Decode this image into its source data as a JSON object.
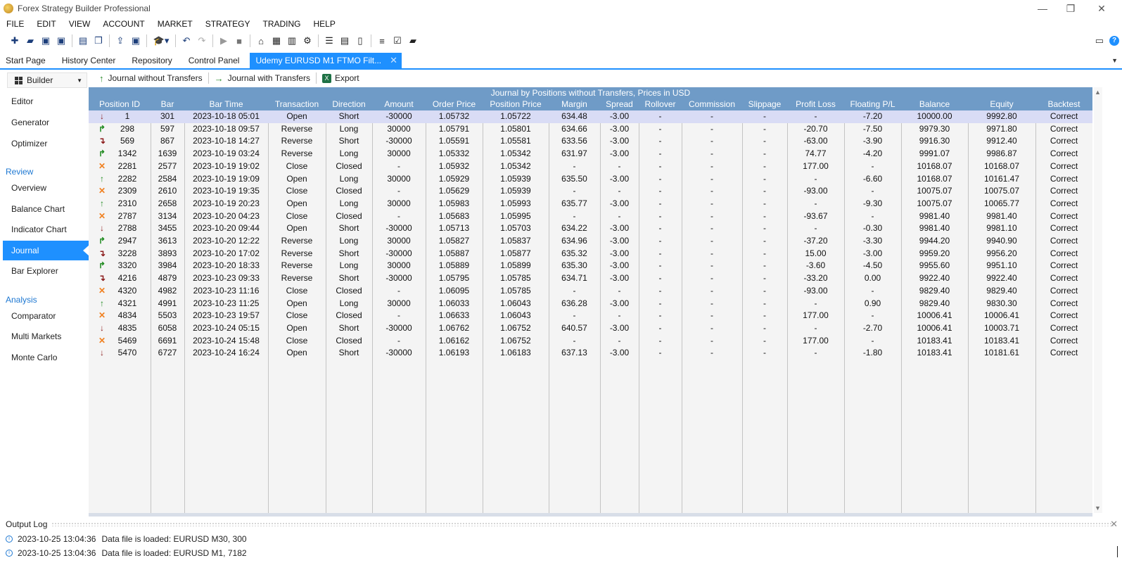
{
  "window": {
    "title": "Forex Strategy Builder Professional",
    "minimize": "—",
    "maximize": "❐",
    "close": "✕"
  },
  "menu": [
    "FILE",
    "EDIT",
    "VIEW",
    "ACCOUNT",
    "MARKET",
    "STRATEGY",
    "TRADING",
    "HELP"
  ],
  "tabs": {
    "items": [
      "Start Page",
      "History Center",
      "Repository",
      "Control Panel"
    ],
    "active": "Udemy  EURUSD  M1  FTMO  Filt...",
    "active_close": "✕"
  },
  "sidebar": {
    "builder_label": "Builder",
    "top_items": [
      "Editor",
      "Generator",
      "Optimizer"
    ],
    "review_header": "Review",
    "review_items": [
      "Overview",
      "Balance Chart",
      "Indicator Chart",
      "Journal",
      "Bar Explorer"
    ],
    "analysis_header": "Analysis",
    "analysis_items": [
      "Comparator",
      "Multi Markets",
      "Monte Carlo"
    ],
    "active_item": "Journal"
  },
  "journal_toolbar": {
    "without_transfers": "Journal without Transfers",
    "with_transfers": "Journal with Transfers",
    "export": "Export"
  },
  "grid": {
    "title": "Journal by Positions without Transfers, Prices in USD",
    "columns": [
      "Position ID",
      "Bar",
      "Bar Time",
      "Transaction",
      "Direction",
      "Amount",
      "Order Price",
      "Position Price",
      "Margin",
      "Spread",
      "Rollover",
      "Commission",
      "Slippage",
      "Profit Loss",
      "Floating P/L",
      "Balance",
      "Equity",
      "Backtest"
    ],
    "rows": [
      {
        "icon": "down",
        "c": [
          "1",
          "301",
          "2023-10-18 05:01",
          "Open",
          "Short",
          "-30000",
          "1.05732",
          "1.05722",
          "634.48",
          "-3.00",
          "-",
          "-",
          "-",
          "-",
          "-7.20",
          "10000.00",
          "9992.80",
          "Correct"
        ]
      },
      {
        "icon": "reverse-up",
        "c": [
          "298",
          "597",
          "2023-10-18 09:57",
          "Reverse",
          "Long",
          "30000",
          "1.05791",
          "1.05801",
          "634.66",
          "-3.00",
          "-",
          "-",
          "-",
          "-20.70",
          "-7.50",
          "9979.30",
          "9971.80",
          "Correct"
        ]
      },
      {
        "icon": "reverse-down",
        "c": [
          "569",
          "867",
          "2023-10-18 14:27",
          "Reverse",
          "Short",
          "-30000",
          "1.05591",
          "1.05581",
          "633.56",
          "-3.00",
          "-",
          "-",
          "-",
          "-63.00",
          "-3.90",
          "9916.30",
          "9912.40",
          "Correct"
        ]
      },
      {
        "icon": "reverse-up",
        "c": [
          "1342",
          "1639",
          "2023-10-19 03:24",
          "Reverse",
          "Long",
          "30000",
          "1.05332",
          "1.05342",
          "631.97",
          "-3.00",
          "-",
          "-",
          "-",
          "74.77",
          "-4.20",
          "9991.07",
          "9986.87",
          "Correct"
        ]
      },
      {
        "icon": "close",
        "c": [
          "2281",
          "2577",
          "2023-10-19 19:02",
          "Close",
          "Closed",
          "-",
          "1.05932",
          "1.05342",
          "-",
          "-",
          "-",
          "-",
          "-",
          "177.00",
          "-",
          "10168.07",
          "10168.07",
          "Correct"
        ]
      },
      {
        "icon": "up",
        "c": [
          "2282",
          "2584",
          "2023-10-19 19:09",
          "Open",
          "Long",
          "30000",
          "1.05929",
          "1.05939",
          "635.50",
          "-3.00",
          "-",
          "-",
          "-",
          "-",
          "-6.60",
          "10168.07",
          "10161.47",
          "Correct"
        ]
      },
      {
        "icon": "close",
        "c": [
          "2309",
          "2610",
          "2023-10-19 19:35",
          "Close",
          "Closed",
          "-",
          "1.05629",
          "1.05939",
          "-",
          "-",
          "-",
          "-",
          "-",
          "-93.00",
          "-",
          "10075.07",
          "10075.07",
          "Correct"
        ]
      },
      {
        "icon": "up",
        "c": [
          "2310",
          "2658",
          "2023-10-19 20:23",
          "Open",
          "Long",
          "30000",
          "1.05983",
          "1.05993",
          "635.77",
          "-3.00",
          "-",
          "-",
          "-",
          "-",
          "-9.30",
          "10075.07",
          "10065.77",
          "Correct"
        ]
      },
      {
        "icon": "close",
        "c": [
          "2787",
          "3134",
          "2023-10-20 04:23",
          "Close",
          "Closed",
          "-",
          "1.05683",
          "1.05995",
          "-",
          "-",
          "-",
          "-",
          "-",
          "-93.67",
          "-",
          "9981.40",
          "9981.40",
          "Correct"
        ]
      },
      {
        "icon": "down",
        "c": [
          "2788",
          "3455",
          "2023-10-20 09:44",
          "Open",
          "Short",
          "-30000",
          "1.05713",
          "1.05703",
          "634.22",
          "-3.00",
          "-",
          "-",
          "-",
          "-",
          "-0.30",
          "9981.40",
          "9981.10",
          "Correct"
        ]
      },
      {
        "icon": "reverse-up",
        "c": [
          "2947",
          "3613",
          "2023-10-20 12:22",
          "Reverse",
          "Long",
          "30000",
          "1.05827",
          "1.05837",
          "634.96",
          "-3.00",
          "-",
          "-",
          "-",
          "-37.20",
          "-3.30",
          "9944.20",
          "9940.90",
          "Correct"
        ]
      },
      {
        "icon": "reverse-down",
        "c": [
          "3228",
          "3893",
          "2023-10-20 17:02",
          "Reverse",
          "Short",
          "-30000",
          "1.05887",
          "1.05877",
          "635.32",
          "-3.00",
          "-",
          "-",
          "-",
          "15.00",
          "-3.00",
          "9959.20",
          "9956.20",
          "Correct"
        ]
      },
      {
        "icon": "reverse-up",
        "c": [
          "3320",
          "3984",
          "2023-10-20 18:33",
          "Reverse",
          "Long",
          "30000",
          "1.05889",
          "1.05899",
          "635.30",
          "-3.00",
          "-",
          "-",
          "-",
          "-3.60",
          "-4.50",
          "9955.60",
          "9951.10",
          "Correct"
        ]
      },
      {
        "icon": "reverse-down",
        "c": [
          "4216",
          "4879",
          "2023-10-23 09:33",
          "Reverse",
          "Short",
          "-30000",
          "1.05795",
          "1.05785",
          "634.71",
          "-3.00",
          "-",
          "-",
          "-",
          "-33.20",
          "0.00",
          "9922.40",
          "9922.40",
          "Correct"
        ]
      },
      {
        "icon": "close",
        "c": [
          "4320",
          "4982",
          "2023-10-23 11:16",
          "Close",
          "Closed",
          "-",
          "1.06095",
          "1.05785",
          "-",
          "-",
          "-",
          "-",
          "-",
          "-93.00",
          "-",
          "9829.40",
          "9829.40",
          "Correct"
        ]
      },
      {
        "icon": "up",
        "c": [
          "4321",
          "4991",
          "2023-10-23 11:25",
          "Open",
          "Long",
          "30000",
          "1.06033",
          "1.06043",
          "636.28",
          "-3.00",
          "-",
          "-",
          "-",
          "-",
          "0.90",
          "9829.40",
          "9830.30",
          "Correct"
        ]
      },
      {
        "icon": "close",
        "c": [
          "4834",
          "5503",
          "2023-10-23 19:57",
          "Close",
          "Closed",
          "-",
          "1.06633",
          "1.06043",
          "-",
          "-",
          "-",
          "-",
          "-",
          "177.00",
          "-",
          "10006.41",
          "10006.41",
          "Correct"
        ]
      },
      {
        "icon": "down",
        "c": [
          "4835",
          "6058",
          "2023-10-24 05:15",
          "Open",
          "Short",
          "-30000",
          "1.06762",
          "1.06752",
          "640.57",
          "-3.00",
          "-",
          "-",
          "-",
          "-",
          "-2.70",
          "10006.41",
          "10003.71",
          "Correct"
        ]
      },
      {
        "icon": "close",
        "c": [
          "5469",
          "6691",
          "2023-10-24 15:48",
          "Close",
          "Closed",
          "-",
          "1.06162",
          "1.06752",
          "-",
          "-",
          "-",
          "-",
          "-",
          "177.00",
          "-",
          "10183.41",
          "10183.41",
          "Correct"
        ]
      },
      {
        "icon": "down",
        "c": [
          "5470",
          "6727",
          "2023-10-24 16:24",
          "Open",
          "Short",
          "-30000",
          "1.06193",
          "1.06183",
          "637.13",
          "-3.00",
          "-",
          "-",
          "-",
          "-",
          "-1.80",
          "10183.41",
          "10181.61",
          "Correct"
        ]
      }
    ]
  },
  "output_log": {
    "title": "Output Log",
    "close": "✕",
    "lines": [
      {
        "time": "2023-10-25 13:04:36",
        "text": "Data file is loaded: EURUSD M30, 300"
      },
      {
        "time": "2023-10-25 13:04:36",
        "text": "Data file is loaded: EURUSD M1, 7182"
      }
    ]
  },
  "colors": {
    "accent": "#1e90ff",
    "grid_header": "#6f9bc7",
    "selected_row": "#d9dcf5",
    "short_arrow": "#8b1a1a",
    "long_arrow": "#1e8a1e",
    "close_mark": "#f08020"
  }
}
